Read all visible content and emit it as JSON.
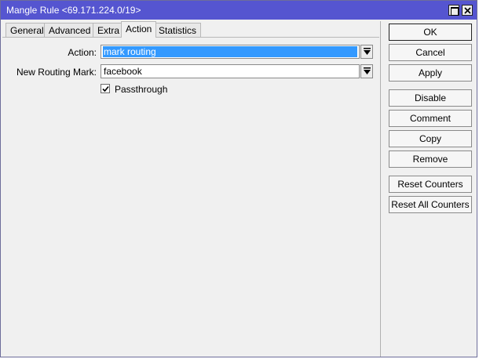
{
  "window": {
    "title": "Mangle Rule <69.171.224.0/19>"
  },
  "tabs": [
    {
      "label": "General"
    },
    {
      "label": "Advanced"
    },
    {
      "label": "Extra"
    },
    {
      "label": "Action",
      "active": true
    },
    {
      "label": "Statistics"
    }
  ],
  "form": {
    "action_label": "Action:",
    "action_value": "mark routing",
    "routing_mark_label": "New Routing Mark:",
    "routing_mark_value": "facebook",
    "passthrough_label": "Passthrough",
    "passthrough_checked": true
  },
  "buttons": {
    "ok": "OK",
    "cancel": "Cancel",
    "apply": "Apply",
    "disable": "Disable",
    "comment": "Comment",
    "copy": "Copy",
    "remove": "Remove",
    "reset_counters": "Reset Counters",
    "reset_all_counters": "Reset All Counters"
  },
  "colors": {
    "titlebar": "#5555d0",
    "selection": "#3399ff"
  },
  "icons": {
    "maximize": "maximize-icon",
    "close": "close-icon",
    "dropdown": "chevron-down-icon",
    "check": "check-icon"
  }
}
